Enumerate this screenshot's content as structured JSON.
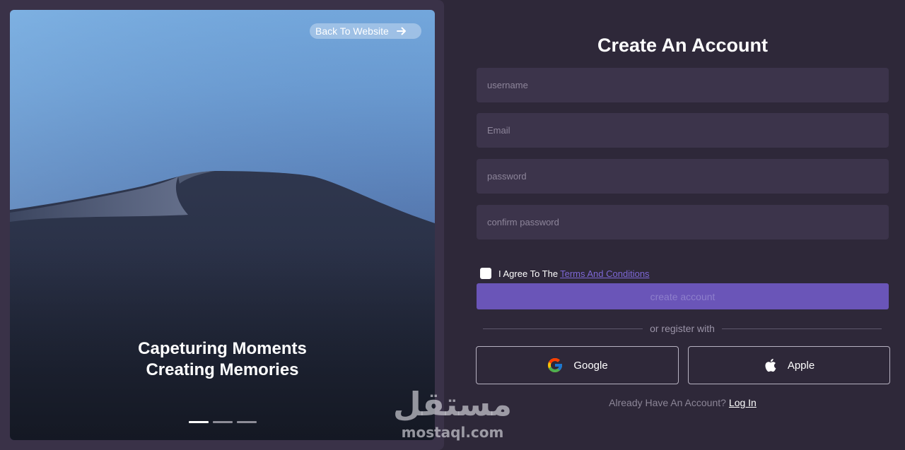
{
  "hero": {
    "back_label": "Back To Website",
    "back_icon": "arrow-right-icon",
    "caption_line1": "Capeturing Moments",
    "caption_line2": "Creating Memories",
    "slides": [
      {
        "active": true
      },
      {
        "active": false
      },
      {
        "active": false
      }
    ]
  },
  "form": {
    "title": "Create An Account",
    "fields": [
      {
        "placeholder": "username"
      },
      {
        "placeholder": "Email"
      },
      {
        "placeholder": "password"
      },
      {
        "placeholder": "confirm password"
      }
    ],
    "agree": {
      "checked": false,
      "text": "I Agree To The",
      "link": "Terms And Conditions"
    },
    "submit_label": "create account",
    "divider_text": "or register with",
    "social": [
      {
        "label": "Google",
        "icon": "google-icon"
      },
      {
        "label": "Apple",
        "icon": "apple-icon"
      }
    ],
    "login_prompt": "Already Have An Account?",
    "login_link": "Log In"
  },
  "watermark": {
    "arabic": "مستقل",
    "latin": "mostaql.com"
  },
  "colors": {
    "background": "#2e2839",
    "panel": "#3a3248",
    "input": "#3c344b",
    "accent": "#6a55b8",
    "link": "#7d68d6"
  }
}
